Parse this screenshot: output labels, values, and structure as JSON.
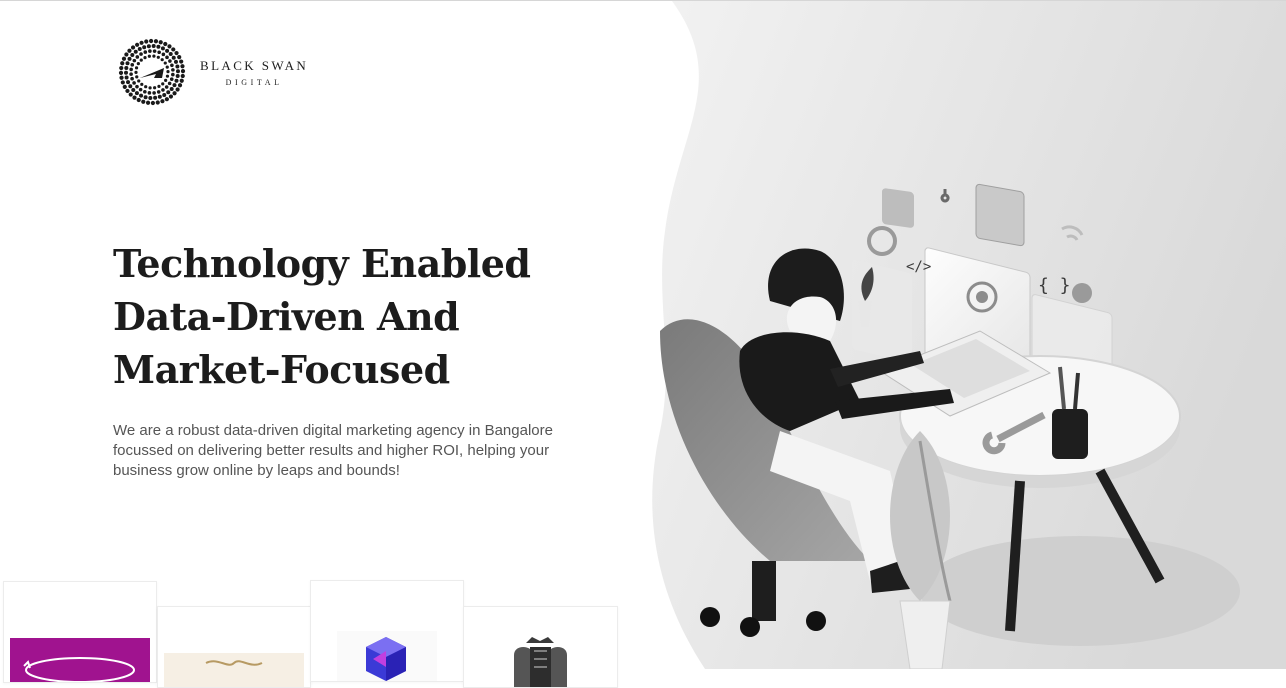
{
  "brand": {
    "name": "BLACK SWAN",
    "subtitle": "DIGITAL"
  },
  "hero": {
    "headline_lines": [
      "Technology Enabled",
      "Data-Driven And",
      "Market-Focused"
    ],
    "description": "We are a robust data-driven digital marketing agency in Bangalore focussed on delivering better results and higher ROI, helping your business grow online by leaps and bounds!"
  },
  "illustration": {
    "subject": "person-at-laptop-illustration",
    "code_symbols": [
      "</>",
      "{ }"
    ]
  },
  "client_logos": [
    {
      "icon": "magenta-oval-logo",
      "color": "#a0138f"
    },
    {
      "icon": "gold-scroll-logo",
      "color": "#b79a63"
    },
    {
      "icon": "blue-hexagon-logo",
      "color": "#3b3ad6"
    },
    {
      "icon": "royal-crest-logo",
      "color": "#3a3a3a"
    }
  ]
}
